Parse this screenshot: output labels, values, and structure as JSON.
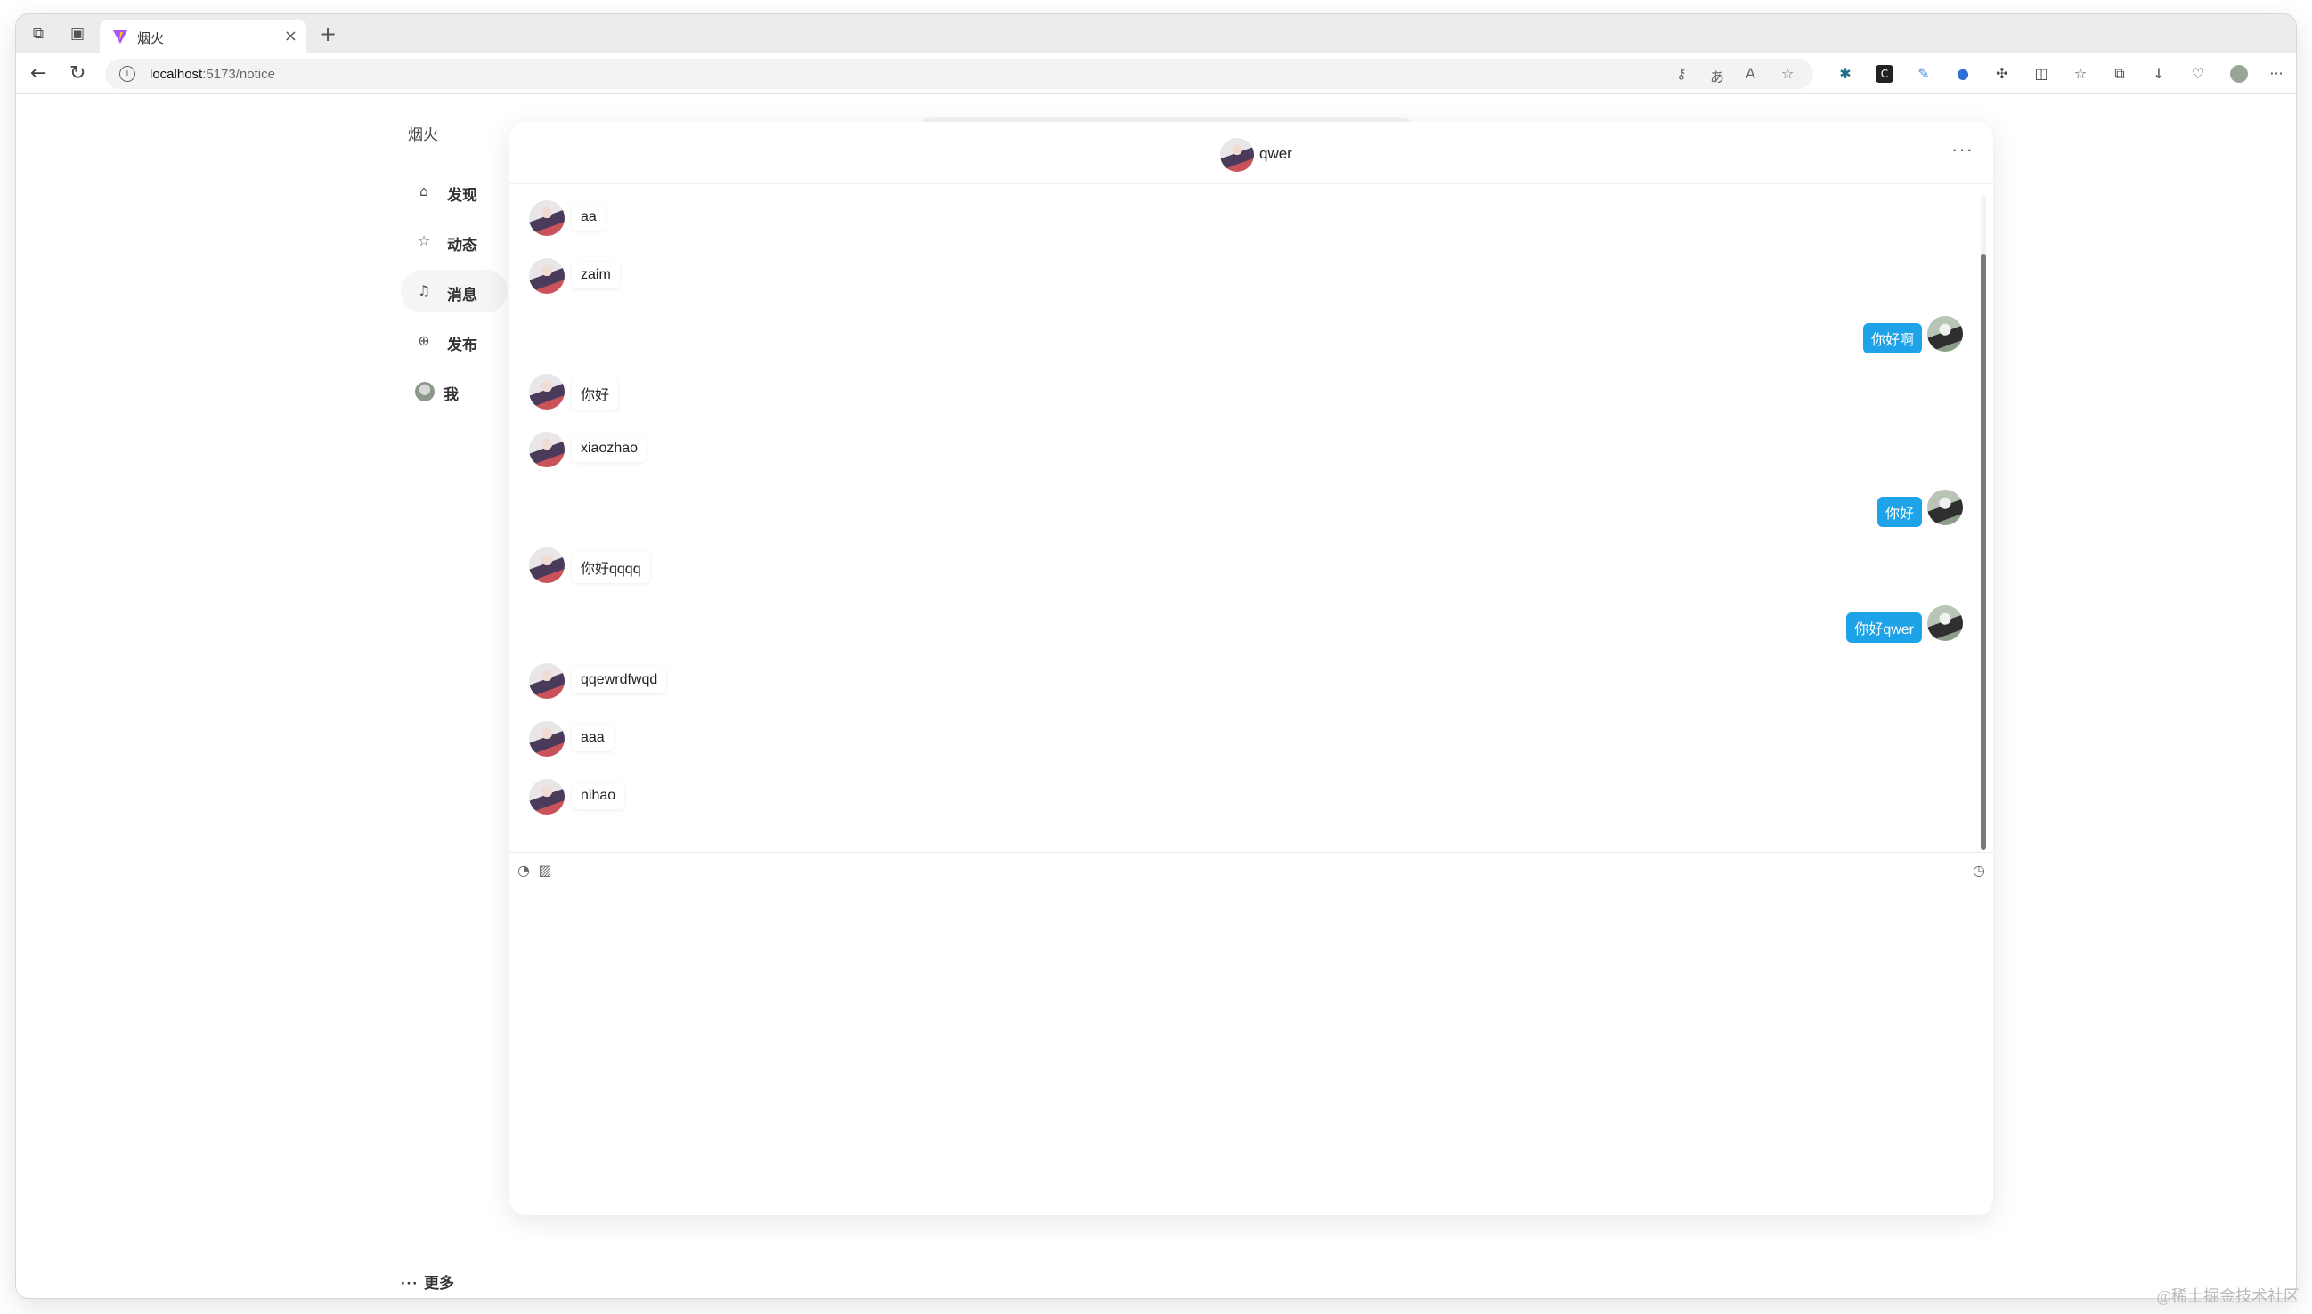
{
  "browser": {
    "tab_title": "烟火",
    "url_host": "localhost",
    "url_path": ":5173/notice",
    "close_glyph": "×",
    "newtab_glyph": "+"
  },
  "sidebar": {
    "brand": "烟火",
    "close_glyph": "✕",
    "items": [
      {
        "label": "发现",
        "icon": "home-icon"
      },
      {
        "label": "动态",
        "icon": "star-icon"
      },
      {
        "label": "消息",
        "icon": "bell-icon",
        "active": true
      },
      {
        "label": "发布",
        "icon": "plus-circle-icon"
      },
      {
        "label": "我",
        "icon": "avatar"
      }
    ],
    "more_label": "更多",
    "more_glyph": "···"
  },
  "chat": {
    "contact_name": "qwer",
    "more_glyph": "···",
    "messages": [
      {
        "side": "left",
        "text": "aa"
      },
      {
        "side": "left",
        "text": "zaim"
      },
      {
        "side": "right",
        "text": "你好啊"
      },
      {
        "side": "left",
        "text": "你好"
      },
      {
        "side": "left",
        "text": "xiaozhao"
      },
      {
        "side": "right",
        "text": "你好"
      },
      {
        "side": "left",
        "text": "你好qqqq"
      },
      {
        "side": "right",
        "text": "你好qwer"
      },
      {
        "side": "left",
        "text": "qqewrdfwqd"
      },
      {
        "side": "left",
        "text": "aaa"
      },
      {
        "side": "left",
        "text": "nihao"
      }
    ],
    "composer": {
      "emoji_icon": "emoji-icon",
      "image_icon": "image-icon",
      "history_icon": "clock-icon",
      "value": ""
    }
  },
  "watermark": "@稀土掘金技术社区",
  "colors": {
    "accent": "#1fa3e8",
    "active_bg": "#f5f5f5"
  }
}
